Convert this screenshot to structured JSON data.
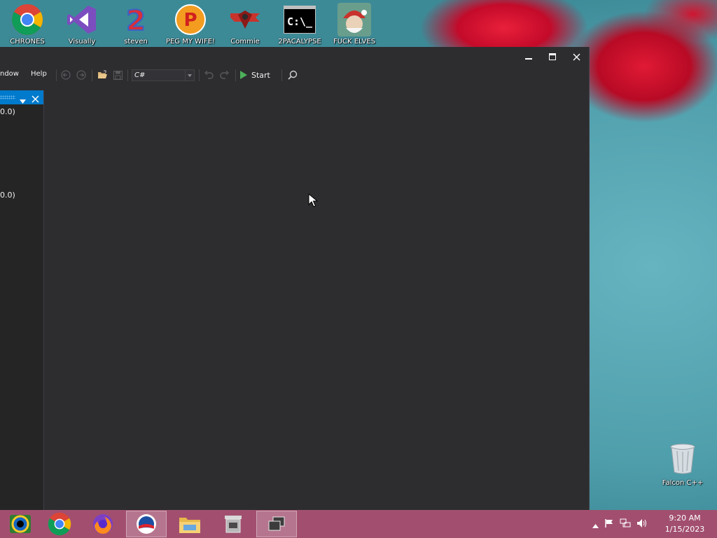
{
  "desktop": {
    "icons": [
      {
        "label": "CHRONES",
        "icon": "chrome-icon"
      },
      {
        "label": "Visually",
        "icon": "visual-studio-icon"
      },
      {
        "label": "steven",
        "icon": "steven-icon"
      },
      {
        "label": "PEG MY WIFE!",
        "icon": "peg-icon"
      },
      {
        "label": "Commie",
        "icon": "commie-icon"
      },
      {
        "label": "2PACALYPSE",
        "icon": "cmd-icon"
      },
      {
        "label": "FUCK ELVES",
        "icon": "elf-icon"
      }
    ],
    "recycle_bin_label": "Falcon C++"
  },
  "ide": {
    "menu": {
      "window_label": "ndow",
      "help_label": "Help"
    },
    "toolbar": {
      "language_selected": "C#",
      "start_label": "Start"
    },
    "side_panel": {
      "line1": "0.0)",
      "line2": "0.0)"
    }
  },
  "taskbar": {
    "items": [
      "windows-logo-icon",
      "chrome-icon",
      "firefox-icon",
      "obama-icon",
      "file-explorer-icon",
      "store-icon",
      "task-view-icon"
    ],
    "clock_time": "9:20 AM",
    "clock_date": "1/15/2023"
  },
  "colors": {
    "ide_bg": "#2d2d30",
    "panel_bg": "#252526",
    "accent": "#007acc",
    "taskbar": "#a24f6f"
  }
}
